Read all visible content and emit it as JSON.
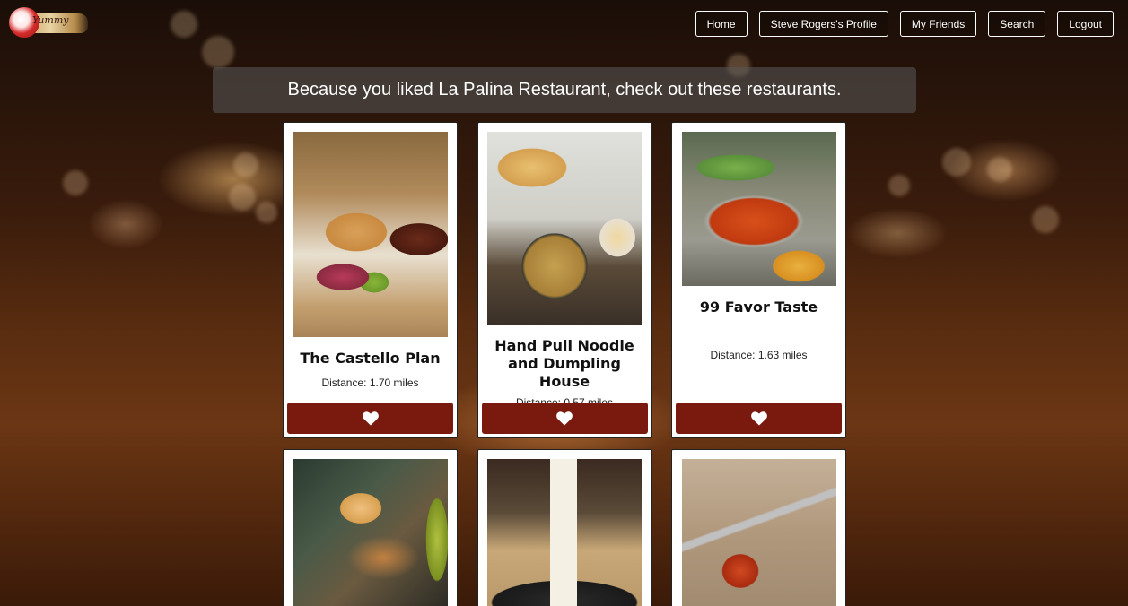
{
  "logo": {
    "text": "Yummy"
  },
  "nav": {
    "items": [
      "Home",
      "Steve Rogers's Profile",
      "My Friends",
      "Search",
      "Logout"
    ]
  },
  "banner": {
    "text": "Because you liked La Palina Restaurant, check out these restaurants."
  },
  "restaurants": [
    {
      "name": "The Castello Plan",
      "distance": "Distance: 1.70 miles",
      "photo": "burger-and-bacon-photo"
    },
    {
      "name": "Hand Pull Noodle and Dumpling House",
      "distance": "Distance: 0.57 miles",
      "photo": "dumplings-and-noodle-soup-photo"
    },
    {
      "name": "99 Favor Taste",
      "distance": "Distance: 1.63 miles",
      "photo": "hot-pot-photo"
    },
    {
      "name": "",
      "distance": "",
      "photo": "dumpling-chopsticks-photo"
    },
    {
      "name": "",
      "distance": "",
      "photo": "noodle-lift-photo"
    },
    {
      "name": "",
      "distance": "",
      "photo": "meatball-fork-photo"
    }
  ],
  "colors": {
    "like_button": "#7a1a0e",
    "card_bg": "#ffffff",
    "banner_bg": "rgba(90,90,90,0.55)"
  },
  "icons": {
    "like": "heart-icon"
  }
}
